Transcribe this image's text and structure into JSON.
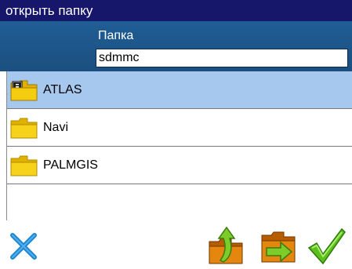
{
  "window": {
    "title": "открыть папку"
  },
  "header": {
    "folder_label": "Папка",
    "path_value": "sdmmc"
  },
  "folders": [
    {
      "name": "ATLAS",
      "selected": true,
      "icon": "open-folder-document-icon"
    },
    {
      "name": "Navi",
      "selected": false,
      "icon": "folder-icon"
    },
    {
      "name": "PALMGIS",
      "selected": false,
      "icon": "folder-icon"
    }
  ],
  "toolbar": {
    "cancel_icon": "close-x-icon",
    "up_icon": "folder-up-icon",
    "move_icon": "folder-move-icon",
    "ok_icon": "checkmark-icon"
  },
  "colors": {
    "titlebar": "#16176b",
    "header": "#1f5e95",
    "selection": "#a7c8ee"
  }
}
